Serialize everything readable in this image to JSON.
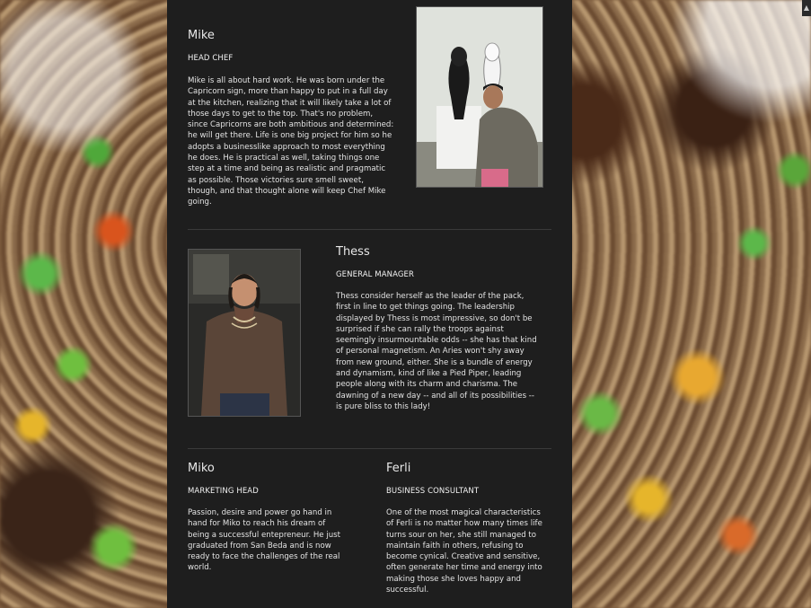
{
  "team": [
    {
      "name": "Mike",
      "role": "HEAD CHEF",
      "bio": "Mike is all about hard work. He was born under the Capricorn sign, more than happy to put in a full day at the kitchen, realizing that it will likely take a lot of those days to get to the top. That's no problem, since Capricorns are both ambitious and determined: he will get there. Life is one big project for him so he adopts a businesslike approach to most everything he does. He is practical as well, taking things one step at a time and being as realistic and pragmatic as possible. Those victories sure smell sweet, though, and that thought alone will keep Chef Mike going."
    },
    {
      "name": "Thess",
      "role": "GENERAL MANAGER",
      "bio": "Thess consider herself as the leader of the pack, first in line to get things going. The leadership displayed by Thess is most impressive, so don't be surprised if she can rally the troops against seemingly insurmountable odds -- she has that kind of personal magnetism. An Aries won't shy away from new ground, either. She is a bundle of energy and dynamism, kind of like a Pied Piper, leading people along with its charm and charisma. The dawning of a new day -- and all of its possibilities -- is pure bliss to this lady!"
    },
    {
      "name": "Miko",
      "role": "MARKETING HEAD",
      "bio": "Passion, desire and power go hand in hand for Miko to reach his dream of being a successful entepreneur.  He just graduated from San Beda and is now ready to face the challenges of the real world."
    },
    {
      "name": "Ferli",
      "role": "BUSINESS CONSULTANT",
      "bio": "One of the most magical characteristics of Ferli is no matter how many times life turns sour on her, she still managed to maintain faith in others, refusing to become cynical.  Creative and sensitive, often generate her time and energy into making those she loves happy and successful."
    }
  ],
  "colors": {
    "panel_bg": "#1e1e1e",
    "text": "#e4e4e4",
    "divider": "#3a3a3a"
  }
}
